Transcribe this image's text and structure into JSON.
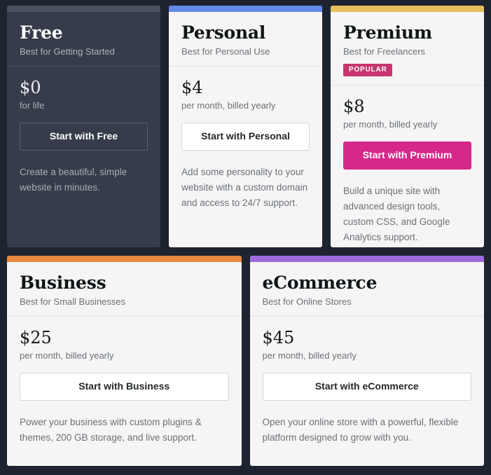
{
  "page": {
    "background_color": "#1E2330"
  },
  "plans": [
    {
      "id": "free",
      "name": "Free",
      "tagline": "Best for Getting Started",
      "badge": null,
      "price": "$0",
      "price_note": "for life",
      "cta_label": "Start with Free",
      "description": "Create a beautiful, simple website in minutes.",
      "accent_color": "#4A5160",
      "theme": "dark",
      "cta_style": "ghost-dark"
    },
    {
      "id": "personal",
      "name": "Personal",
      "tagline": "Best for Personal Use",
      "badge": null,
      "price": "$4",
      "price_note": "per month, billed yearly",
      "cta_label": "Start with Personal",
      "description": "Add some personality to your website with a custom domain and access to 24/7 support.",
      "accent_color": "#6288E8",
      "theme": "light",
      "cta_style": "outline"
    },
    {
      "id": "premium",
      "name": "Premium",
      "tagline": "Best for Freelancers",
      "badge": "POPULAR",
      "badge_color": "#C9356E",
      "price": "$8",
      "price_note": "per month, billed yearly",
      "cta_label": "Start with Premium",
      "description": "Build a unique site with advanced design tools, custom CSS, and Google Analytics support.",
      "accent_color": "#E3C05C",
      "theme": "light",
      "cta_style": "primary",
      "cta_color": "#D6288A"
    },
    {
      "id": "business",
      "name": "Business",
      "tagline": "Best for Small Businesses",
      "badge": null,
      "price": "$25",
      "price_note": "per month, billed yearly",
      "cta_label": "Start with Business",
      "description": "Power your business with custom plugins & themes, 200 GB storage, and live support.",
      "accent_color": "#E68A3E",
      "theme": "light",
      "cta_style": "outline"
    },
    {
      "id": "ecommerce",
      "name": "eCommerce",
      "tagline": "Best for Online Stores",
      "badge": null,
      "price": "$45",
      "price_note": "per month, billed yearly",
      "cta_label": "Start with eCommerce",
      "description": "Open your online store with a powerful, flexible platform designed to grow with you.",
      "accent_color": "#A069DD",
      "theme": "light",
      "cta_style": "outline"
    }
  ]
}
